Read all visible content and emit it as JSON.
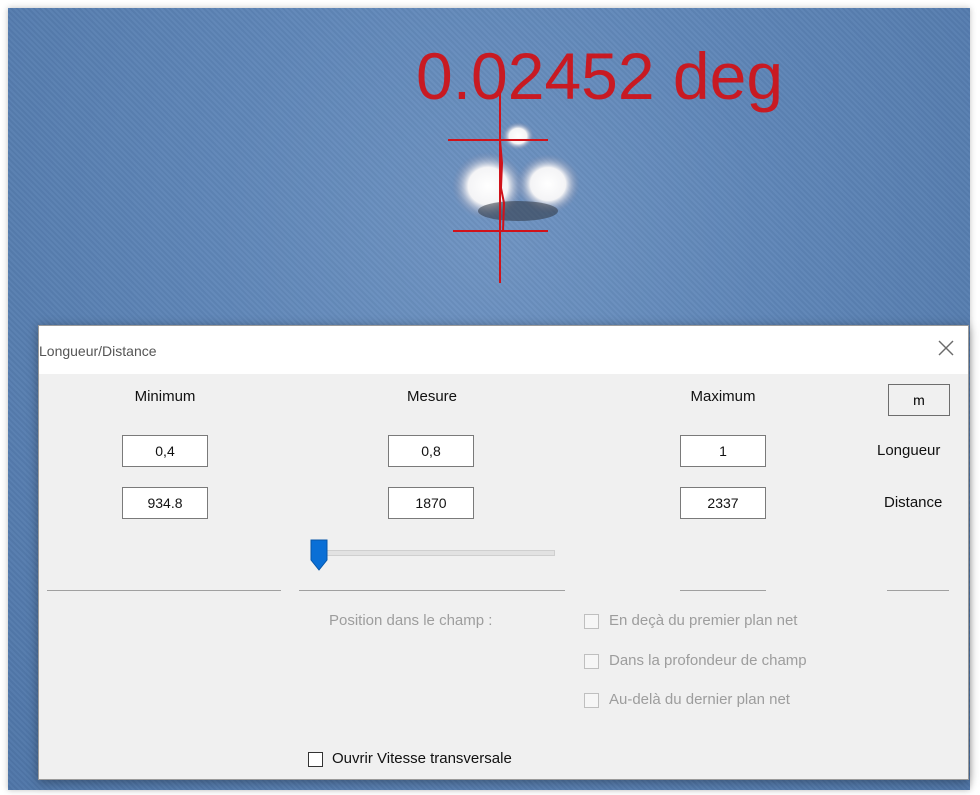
{
  "overlay": {
    "measurement": "0.02452 deg"
  },
  "dialog": {
    "title": "Longueur/Distance",
    "close_icon": "close-icon",
    "columns": {
      "min": "Minimum",
      "measure": "Mesure",
      "max": "Maximum"
    },
    "unit_button": "m",
    "rows": {
      "length_label": "Longueur",
      "distance_label": "Distance"
    },
    "values": {
      "length": {
        "min": "0,4",
        "measure": "0,8",
        "max": "1"
      },
      "distance": {
        "min": "934.8",
        "measure": "1870",
        "max": "2337"
      }
    },
    "slider": {
      "position_fraction": 0.0
    },
    "position_label": "Position dans le champ :",
    "options": [
      {
        "label": "En deçà du premier plan net",
        "checked": false,
        "enabled": false
      },
      {
        "label": "Dans la profondeur de champ",
        "checked": false,
        "enabled": false
      },
      {
        "label": "Au-delà du dernier plan net",
        "checked": false,
        "enabled": false
      }
    ],
    "transverse_checkbox": {
      "label": "Ouvrir Vitesse transversale",
      "checked": false
    }
  }
}
